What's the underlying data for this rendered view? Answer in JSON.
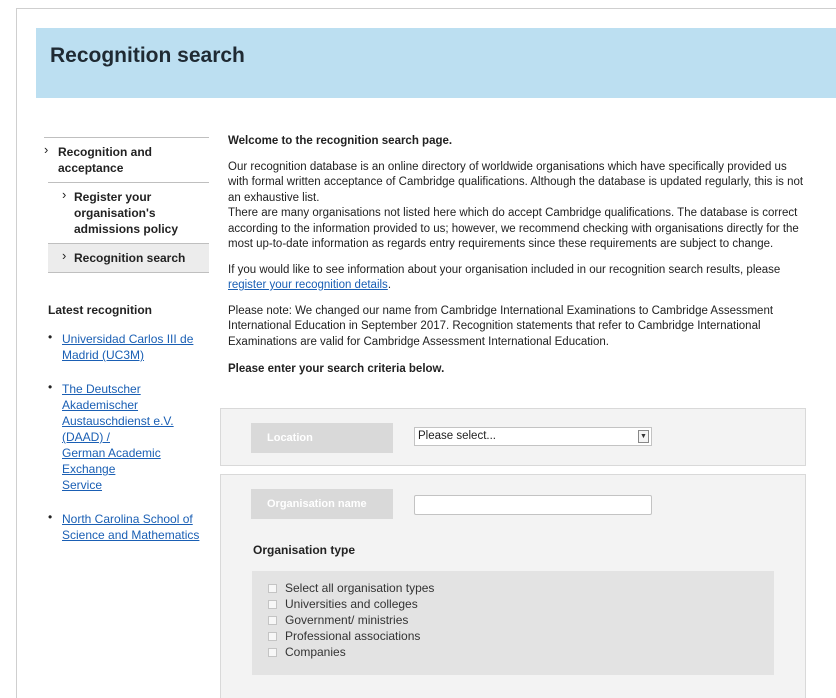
{
  "page_title": "Recognition search",
  "sidebar": {
    "nav": [
      {
        "label": "Recognition and acceptance",
        "line1": "Recognition and",
        "line2": "acceptance"
      },
      {
        "label": "Register your organisation's admissions policy",
        "line1": "Register your",
        "line2": "organisation's",
        "line3": "admissions policy"
      },
      {
        "label": "Recognition search"
      }
    ],
    "latest_title": "Latest recognition",
    "latest": [
      {
        "l1": "Universidad Carlos III de",
        "l2": "Madrid (UC3M)"
      },
      {
        "l1": "The Deutscher",
        "l2": "Akademischer",
        "l3": "Austauschdienst e.V. (DAAD) /",
        "l4": "German Academic Exchange",
        "l5": "Service"
      },
      {
        "l1": "North Carolina School of",
        "l2": "Science and Mathematics"
      }
    ]
  },
  "main": {
    "welcome": "Welcome to the recognition search page.",
    "p1": "Our recognition database is an online directory of worldwide organisations which have specifically provided us with formal written acceptance of Cambridge qualifications. Although the database is updated regularly, this is not an exhaustive list.",
    "p2": "There are many organisations not listed here which do accept Cambridge qualifications. The database is correct according to the information provided to us; however, we recommend checking with organisations directly for the most up-to-date information as regards entry requirements since these requirements are subject to change.",
    "p3_text": "If you would like to see information about your organisation included in our recognition search results, please",
    "p3_link": "register your recognition details",
    "p3_end": ".",
    "p4": "Please note: We changed our name from Cambridge International Examinations to Cambridge Assessment International Education in September 2017. Recognition statements that refer to Cambridge International Examinations are valid for Cambridge Assessment International Education.",
    "criteria": "Please enter your search criteria below."
  },
  "search": {
    "location_label": "Location",
    "location_value": "Please select...",
    "org_name_label": "Organisation name",
    "org_name_value": "",
    "org_type_title": "Organisation type",
    "org_types": [
      "Select all organisation types",
      "Universities and colleges",
      "Government/ ministries",
      "Professional associations",
      "Companies"
    ]
  }
}
